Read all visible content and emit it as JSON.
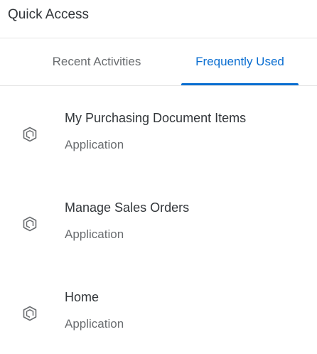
{
  "panel": {
    "title": "Quick Access"
  },
  "tabs": [
    {
      "label": "Recent Activities",
      "selected": false
    },
    {
      "label": "Frequently Used",
      "selected": true
    }
  ],
  "colors": {
    "accent": "#0a6ed1",
    "text": "#32363a",
    "muted": "#6a6d70"
  },
  "items": [
    {
      "title": "My Purchasing Document Items",
      "subtitle": "Application",
      "icon": "app-cube-icon"
    },
    {
      "title": "Manage Sales Orders",
      "subtitle": "Application",
      "icon": "app-cube-icon"
    },
    {
      "title": "Home",
      "subtitle": "Application",
      "icon": "app-cube-icon"
    }
  ]
}
